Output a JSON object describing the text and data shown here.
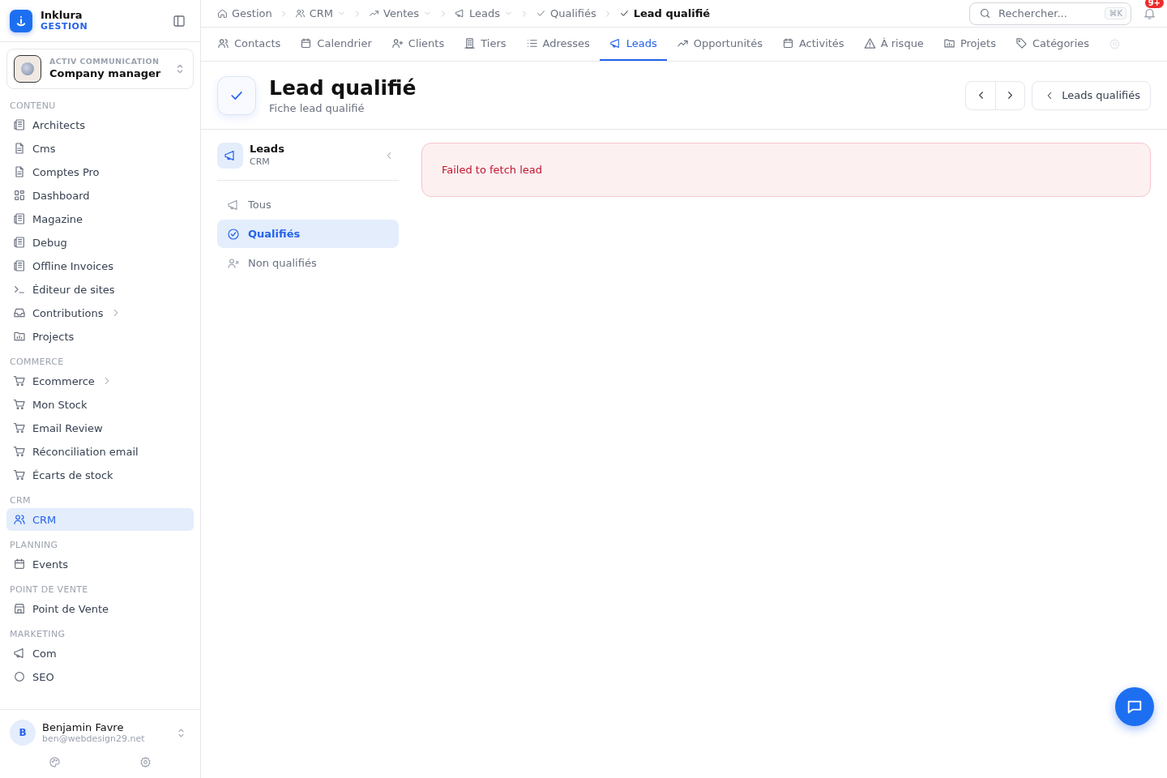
{
  "app": {
    "name": "Inklura",
    "subtitle": "GESTION"
  },
  "workspace": {
    "company": "ACTIV COMMUNICATION",
    "role": "Company manager"
  },
  "sidebar": {
    "sections": [
      {
        "title": "CONTENU",
        "items": [
          {
            "label": "Architects",
            "selected": false,
            "expandable": false
          },
          {
            "label": "Cms",
            "selected": false,
            "expandable": false
          },
          {
            "label": "Comptes Pro",
            "selected": false,
            "expandable": false
          },
          {
            "label": "Dashboard",
            "selected": false,
            "expandable": false
          },
          {
            "label": "Magazine",
            "selected": false,
            "expandable": false
          },
          {
            "label": "Debug",
            "selected": false,
            "expandable": false
          },
          {
            "label": "Offline Invoices",
            "selected": false,
            "expandable": false
          },
          {
            "label": "Éditeur de sites",
            "selected": false,
            "expandable": false
          },
          {
            "label": "Contributions",
            "selected": false,
            "expandable": true
          },
          {
            "label": "Projects",
            "selected": false,
            "expandable": false
          }
        ]
      },
      {
        "title": "COMMERCE",
        "items": [
          {
            "label": "Ecommerce",
            "selected": false,
            "expandable": true
          },
          {
            "label": "Mon Stock",
            "selected": false,
            "expandable": false
          },
          {
            "label": "Email Review",
            "selected": false,
            "expandable": false
          },
          {
            "label": "Réconciliation email",
            "selected": false,
            "expandable": false
          },
          {
            "label": "Écarts de stock",
            "selected": false,
            "expandable": false
          }
        ]
      },
      {
        "title": "CRM",
        "items": [
          {
            "label": "CRM",
            "selected": true,
            "expandable": false
          }
        ]
      },
      {
        "title": "PLANNING",
        "items": [
          {
            "label": "Events",
            "selected": false,
            "expandable": false
          }
        ]
      },
      {
        "title": "POINT DE VENTE",
        "items": [
          {
            "label": "Point de Vente",
            "selected": false,
            "expandable": false
          }
        ]
      },
      {
        "title": "MARKETING",
        "items": [
          {
            "label": "Com",
            "selected": false,
            "expandable": false
          },
          {
            "label": "SEO",
            "selected": false,
            "expandable": false
          }
        ]
      }
    ]
  },
  "user": {
    "initial": "B",
    "name": "Benjamin Favre",
    "email": "ben@webdesign29.net"
  },
  "breadcrumbs": [
    {
      "label": "Gestion",
      "dropdown": false,
      "current": false
    },
    {
      "label": "CRM",
      "dropdown": true,
      "current": false
    },
    {
      "label": "Ventes",
      "dropdown": true,
      "current": false
    },
    {
      "label": "Leads",
      "dropdown": true,
      "current": false
    },
    {
      "label": "Qualifiés",
      "dropdown": false,
      "current": false
    },
    {
      "label": "Lead qualifié",
      "dropdown": false,
      "current": true
    }
  ],
  "search": {
    "placeholder": "Rechercher...",
    "shortcut": "⌘K"
  },
  "notifications": {
    "badge": "9+"
  },
  "tabs": [
    {
      "label": "Contacts",
      "selected": false
    },
    {
      "label": "Calendrier",
      "selected": false
    },
    {
      "label": "Clients",
      "selected": false
    },
    {
      "label": "Tiers",
      "selected": false
    },
    {
      "label": "Adresses",
      "selected": false
    },
    {
      "label": "Leads",
      "selected": true
    },
    {
      "label": "Opportunités",
      "selected": false
    },
    {
      "label": "Activités",
      "selected": false
    },
    {
      "label": "À risque",
      "selected": false
    },
    {
      "label": "Projets",
      "selected": false
    },
    {
      "label": "Catégories",
      "selected": false
    }
  ],
  "header": {
    "title": "Lead qualifié",
    "subtitle": "Fiche lead qualifié",
    "back_button": "Leads qualifiés"
  },
  "subnav": {
    "title": "Leads",
    "subtitle": "CRM",
    "items": [
      {
        "label": "Tous",
        "selected": false
      },
      {
        "label": "Qualifiés",
        "selected": true
      },
      {
        "label": "Non qualifiés",
        "selected": false
      }
    ]
  },
  "error": {
    "message": "Failed to fetch lead"
  }
}
